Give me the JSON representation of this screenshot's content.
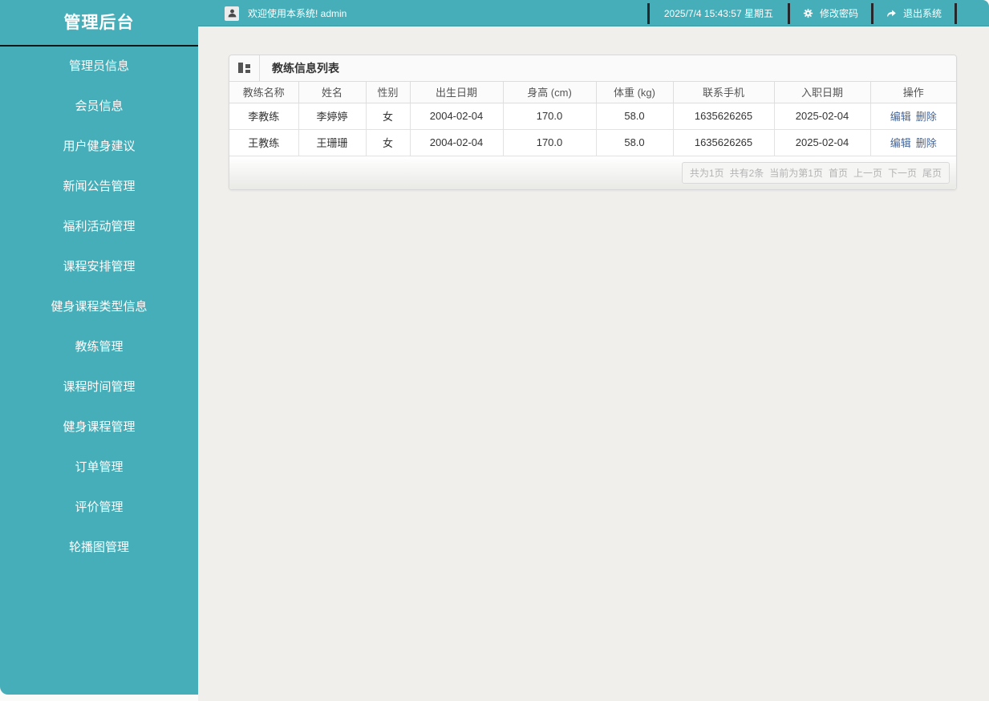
{
  "app": {
    "title": "管理后台"
  },
  "sidebar": {
    "items": [
      "管理员信息",
      "会员信息",
      "用户健身建议",
      "新闻公告管理",
      "福利活动管理",
      "课程安排管理",
      "健身课程类型信息",
      "教练管理",
      "课程时间管理",
      "健身课程管理",
      "订单管理",
      "评价管理",
      "轮播图管理"
    ]
  },
  "topbar": {
    "welcome": "欢迎使用本系统! admin",
    "datetime": "2025/7/4 15:43:57 星期五",
    "change_password": "修改密码",
    "logout": "退出系统",
    "icons": {
      "user": "user-icon",
      "gear": "gear-icon",
      "logout": "logout-arrow-icon"
    }
  },
  "panel": {
    "title": "教练信息列表",
    "header_icon": "blocks-icon",
    "table": {
      "columns": [
        "教练名称",
        "姓名",
        "性别",
        "出生日期",
        "身高 (cm)",
        "体重 (kg)",
        "联系手机",
        "入职日期",
        "操作"
      ],
      "rows": [
        {
          "coach": "李教练",
          "name": "李婷婷",
          "gender": "女",
          "birth": "2004-02-04",
          "height": "170.0",
          "weight": "58.0",
          "phone": "1635626265",
          "hire": "2025-02-04"
        },
        {
          "coach": "王教练",
          "name": "王珊珊",
          "gender": "女",
          "birth": "2004-02-04",
          "height": "170.0",
          "weight": "58.0",
          "phone": "1635626265",
          "hire": "2025-02-04"
        }
      ],
      "actions": {
        "edit": "编辑",
        "delete": "删除"
      }
    },
    "pagination": {
      "info": [
        "共为1页",
        "共有2条",
        "当前为第1页"
      ],
      "links": [
        "首页",
        "上一页",
        "下一页",
        "尾页"
      ]
    }
  },
  "colors": {
    "accent_teal": "#46aeb8",
    "topbar_divider": "#24272b",
    "link_blue": "#44669c",
    "content_bg": "#f0efec"
  }
}
